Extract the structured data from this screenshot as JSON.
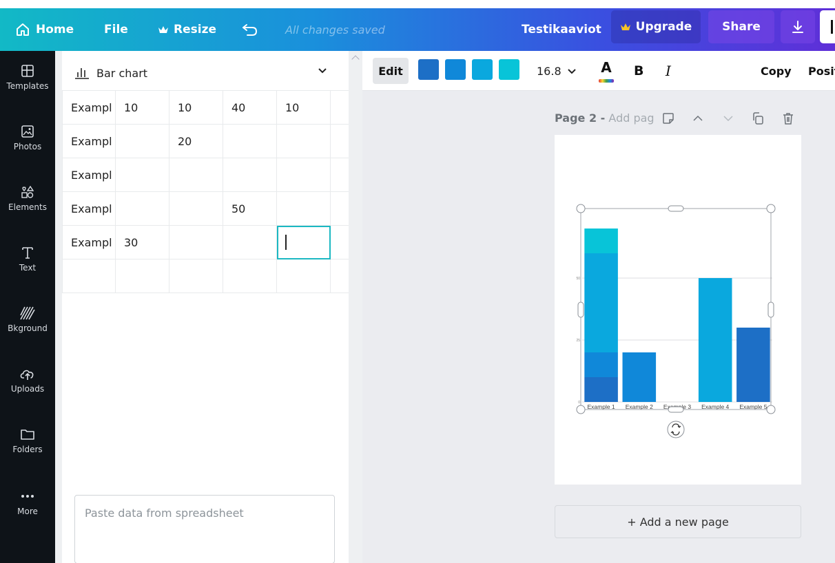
{
  "topbar": {
    "home": "Home",
    "file": "File",
    "resize": "Resize",
    "saved": "All changes saved",
    "doc_title": "Testikaaviot",
    "upgrade": "Upgrade",
    "share": "Share",
    "gradient_start": "#12b9c6",
    "gradient_end": "#5f2fd8"
  },
  "nav": {
    "items": [
      {
        "label": "Templates",
        "icon": "templates-icon"
      },
      {
        "label": "Photos",
        "icon": "photos-icon"
      },
      {
        "label": "Elements",
        "icon": "elements-icon"
      },
      {
        "label": "Text",
        "icon": "text-icon"
      },
      {
        "label": "Bkground",
        "icon": "background-icon"
      },
      {
        "label": "Uploads",
        "icon": "uploads-icon"
      },
      {
        "label": "Folders",
        "icon": "folders-icon"
      },
      {
        "label": "More",
        "icon": "more-icon"
      }
    ]
  },
  "panel": {
    "chart_type": "Bar chart",
    "rows": [
      [
        "Exampl",
        "10",
        "10",
        "40",
        "10",
        ""
      ],
      [
        "Exampl",
        "",
        "20",
        "",
        "",
        ""
      ],
      [
        "Exampl",
        "",
        "",
        "",
        "",
        ""
      ],
      [
        "Exampl",
        "",
        "",
        "50",
        "",
        ""
      ],
      [
        "Exampl",
        "30",
        "",
        "",
        "",
        ""
      ],
      [
        "",
        "",
        "",
        "",
        "",
        ""
      ]
    ],
    "paste_placeholder": "Paste data from spreadsheet"
  },
  "toolbar": {
    "edit": "Edit",
    "colors": [
      "#1d6fc6",
      "#1088d9",
      "#0aa8de",
      "#08c4d8"
    ],
    "font_size": "16.8",
    "text_color_letter": "A",
    "bold": "B",
    "italic": "I",
    "copy": "Copy",
    "position": "Posit"
  },
  "page": {
    "label": "Page 2 -",
    "add_title": "Add page title",
    "add_page": "+ Add a new page"
  },
  "chart_data": {
    "type": "bar",
    "stacked": true,
    "categories": [
      "Example 1",
      "Example 2",
      "Example 3",
      "Example 4",
      "Example 5"
    ],
    "series": [
      {
        "values": [
          10,
          0,
          0,
          0,
          30
        ],
        "color": "#1d6fc6"
      },
      {
        "values": [
          10,
          20,
          0,
          0,
          0
        ],
        "color": "#1088d9"
      },
      {
        "values": [
          40,
          0,
          0,
          50,
          0
        ],
        "color": "#0aa8de"
      },
      {
        "values": [
          10,
          0,
          0,
          0,
          0
        ],
        "color": "#08c4d8"
      }
    ],
    "y_ticks": [
      "0",
      "25",
      "50"
    ],
    "ylim": [
      0,
      75
    ],
    "grid": true
  }
}
